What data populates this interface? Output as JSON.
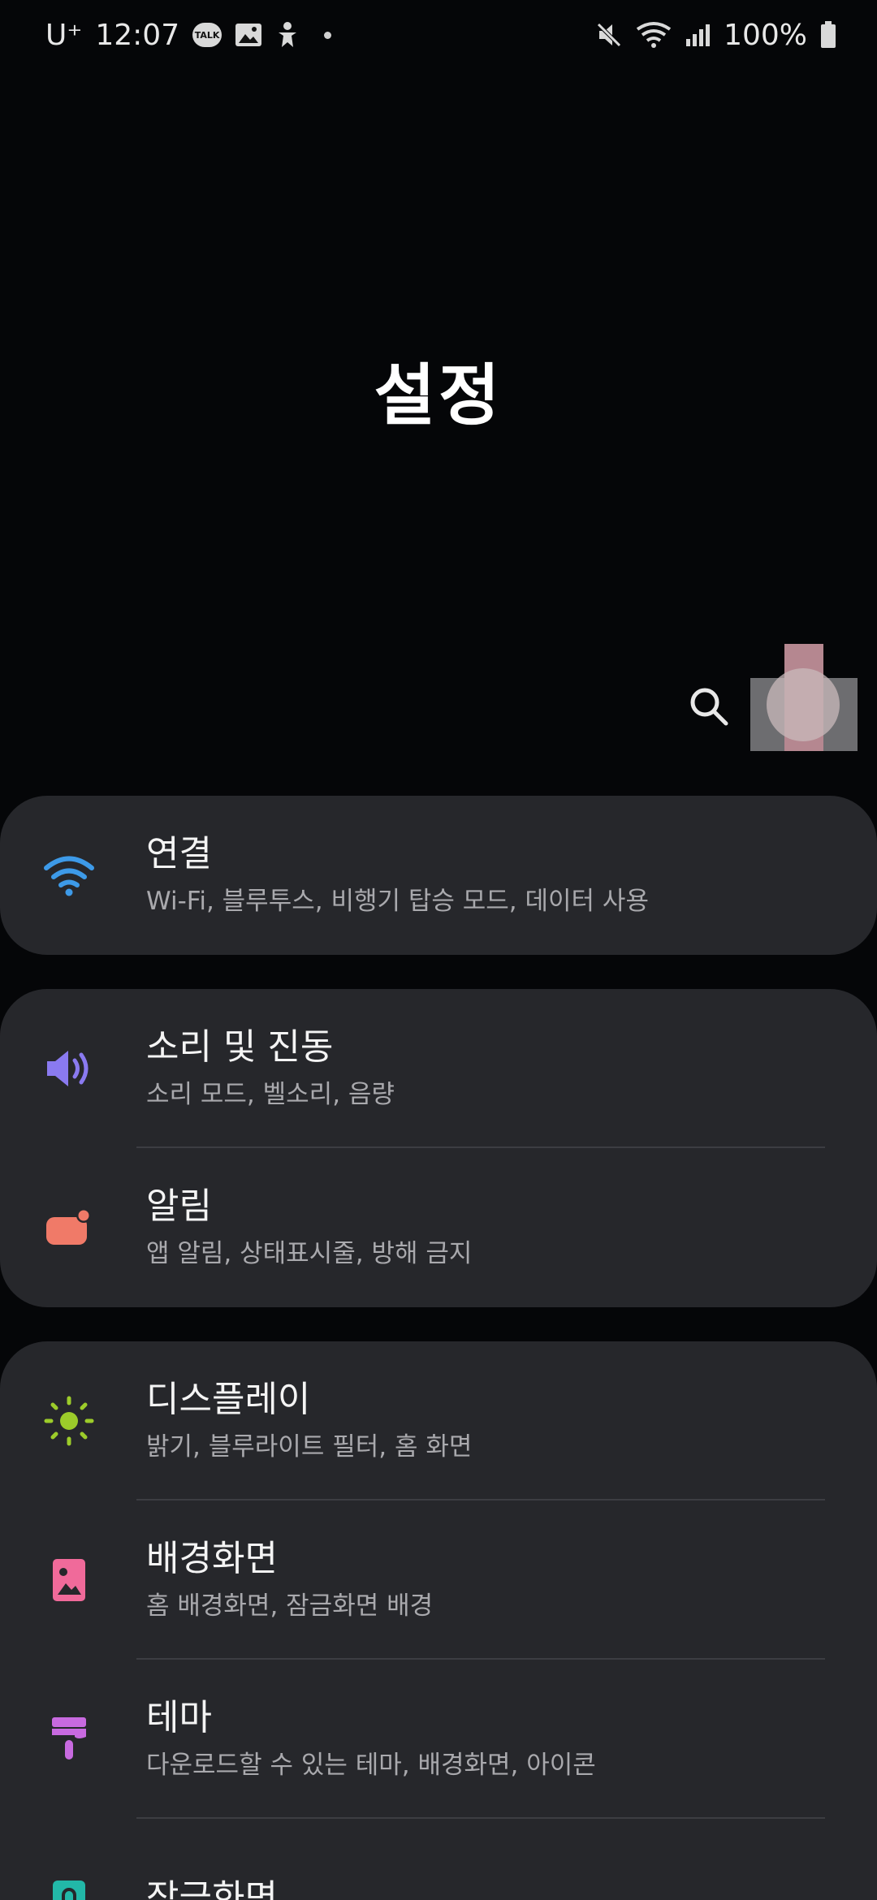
{
  "status_bar": {
    "carrier": "U⁺",
    "time": "12:07",
    "talk_badge": "TALK",
    "battery": "100%"
  },
  "header": {
    "title": "설정"
  },
  "colors": {
    "background": "#050608",
    "card": "#26272b",
    "wifi_icon": "#3d9ae8",
    "sound_icon": "#8a7af0",
    "notification_icon": "#f07a68",
    "display_icon": "#9ccc2a",
    "wallpaper_icon": "#f06a9a",
    "theme_icon": "#c86ae0",
    "lockscreen_icon": "#22b8a8"
  },
  "settings": {
    "connections": {
      "title": "연결",
      "subtitle": "Wi-Fi, 블루투스, 비행기 탑승 모드, 데이터 사용"
    },
    "sound": {
      "title": "소리 및 진동",
      "subtitle": "소리 모드, 벨소리, 음량"
    },
    "notifications": {
      "title": "알림",
      "subtitle": "앱 알림, 상태표시줄, 방해 금지"
    },
    "display": {
      "title": "디스플레이",
      "subtitle": "밝기, 블루라이트 필터, 홈 화면"
    },
    "wallpaper": {
      "title": "배경화면",
      "subtitle": "홈 배경화면, 잠금화면 배경"
    },
    "themes": {
      "title": "테마",
      "subtitle": "다운로드할 수 있는 테마, 배경화면, 아이콘"
    },
    "lockscreen": {
      "title": "잠금화면",
      "subtitle": ""
    }
  }
}
